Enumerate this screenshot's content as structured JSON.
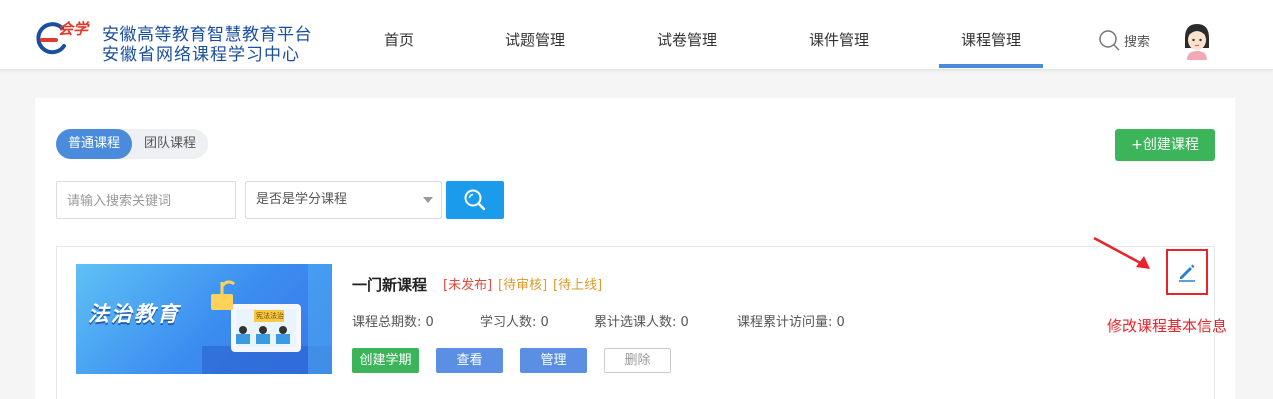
{
  "header": {
    "logo": {
      "brand": "会学",
      "line1": "安徽高等教育智慧教育平台",
      "line2": "安徽省网络课程学习中心"
    },
    "nav": [
      {
        "label": "首页"
      },
      {
        "label": "试题管理"
      },
      {
        "label": "试卷管理"
      },
      {
        "label": "课件管理"
      },
      {
        "label": "课程管理",
        "active": true
      }
    ],
    "search_label": "搜索",
    "accent_color": "#4a8bdc"
  },
  "filters": {
    "tabs": [
      {
        "label": "普通课程",
        "active": true
      },
      {
        "label": "团队课程"
      }
    ],
    "create_button": "+创建课程",
    "search_placeholder": "请输入搜索关键词",
    "credit_select": "是否是学分课程"
  },
  "course": {
    "cover_text": "法治教育",
    "cover_sign": "宪法法治",
    "title": "一门新课程",
    "tags": [
      "[未发布]",
      "[待审核]",
      "[待上线]"
    ],
    "stats": [
      {
        "label": "课程总期数:",
        "value": "0"
      },
      {
        "label": "学习人数:",
        "value": "0"
      },
      {
        "label": "累计选课人数:",
        "value": "0"
      },
      {
        "label": "课程累计访问量:",
        "value": "0"
      }
    ],
    "actions": {
      "create_term": "创建学期",
      "view": "查看",
      "manage": "管理",
      "delete": "删除"
    }
  },
  "annotation": {
    "text": "修改课程基本信息",
    "color": "#e8242a"
  }
}
